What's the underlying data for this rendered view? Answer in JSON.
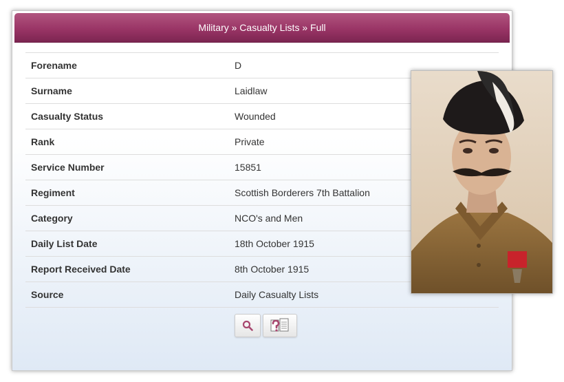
{
  "header": {
    "title": "Military » Casualty Lists » Full"
  },
  "details": [
    {
      "label": "Forename",
      "value": "D"
    },
    {
      "label": "Surname",
      "value": "Laidlaw"
    },
    {
      "label": "Casualty Status",
      "value": "Wounded"
    },
    {
      "label": "Rank",
      "value": "Private"
    },
    {
      "label": "Service Number",
      "value": "15851"
    },
    {
      "label": "Regiment",
      "value": "Scottish Borderers 7th Battalion"
    },
    {
      "label": "Category",
      "value": "NCO's and Men"
    },
    {
      "label": "Daily List Date",
      "value": "18th October 1915"
    },
    {
      "label": "Report Received Date",
      "value": "8th October 1915"
    },
    {
      "label": "Source",
      "value": "Daily Casualty Lists"
    }
  ],
  "buttons": [
    {
      "icon": "search-icon"
    },
    {
      "icon": "help-document-icon"
    }
  ],
  "colors": {
    "header_top": "#b1557f",
    "header_bottom": "#7c2551",
    "panel_gradient_bottom": "#dfe9f5",
    "icon_accent": "#a8476f"
  }
}
